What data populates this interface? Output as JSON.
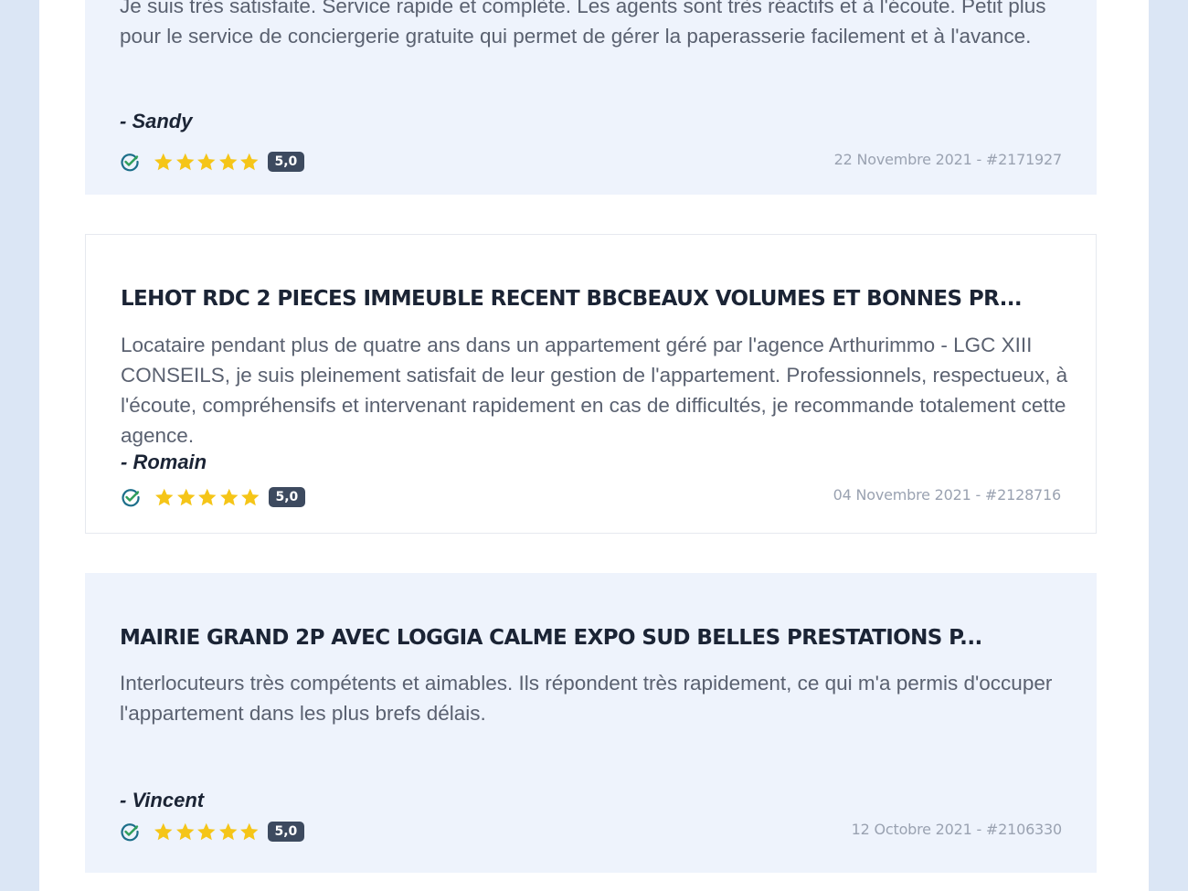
{
  "reviews": [
    {
      "title": "",
      "text": "Je suis très satisfaite. Service rapide et complète. Les agents sont très réactifs et à l'écoute. Petit plus pour le service de conciergerie gratuite qui permet de gérer la paperasserie facilement et à l'avance.",
      "author": "- Sandy",
      "rating": "5,0",
      "stars": 5,
      "date_ref": "22 Novembre 2021 - #2171927"
    },
    {
      "title": "LEHOT RDC 2 PIECES IMMEUBLE RECENT BBCBEAUX VOLUMES ET BONNES PR...",
      "text": "Locataire pendant plus de quatre ans dans un appartement géré par l'agence Arthurimmo - LGC XIII CONSEILS, je suis pleinement satisfait de leur gestion de l'appartement. Professionnels, respectueux, à l'écoute, compréhensifs et intervenant rapidement en cas de difficultés, je recommande totalement cette agence.",
      "author": "- Romain",
      "rating": "5,0",
      "stars": 5,
      "date_ref": "04 Novembre 2021 - #2128716"
    },
    {
      "title": "MAIRIE GRAND 2P AVEC LOGGIA CALME EXPO SUD BELLES PRESTATIONS P...",
      "text": "Interlocuteurs très compétents et aimables. Ils répondent très rapidement, ce qui m'a permis d'occuper l'appartement dans les plus brefs délais.",
      "author": "- Vincent",
      "rating": "5,0",
      "stars": 5,
      "date_ref": "12 Octobre 2021 - #2106330"
    }
  ],
  "colors": {
    "star": "#f5c518",
    "verified": "#1d6f8a",
    "verified_check": "#2f9e5a",
    "badge": "#3d4a5f",
    "card_shaded": "#eef3fc"
  },
  "icons": {
    "verified": "verified-check-icon",
    "star": "star-icon"
  }
}
